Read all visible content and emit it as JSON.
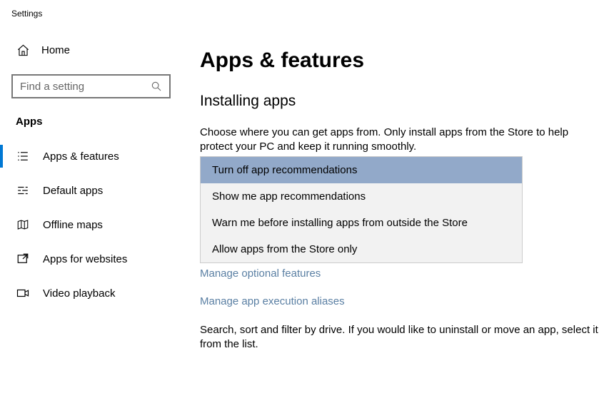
{
  "window_title": "Settings",
  "sidebar": {
    "home_label": "Home",
    "search_placeholder": "Find a setting",
    "section_title": "Apps",
    "items": [
      {
        "label": "Apps & features"
      },
      {
        "label": "Default apps"
      },
      {
        "label": "Offline maps"
      },
      {
        "label": "Apps for websites"
      },
      {
        "label": "Video playback"
      }
    ]
  },
  "main": {
    "title": "Apps & features",
    "subsection": "Installing apps",
    "description": "Choose where you can get apps from. Only install apps from the Store to help protect your PC and keep it running smoothly.",
    "dropdown": {
      "options": [
        "Turn off app recommendations",
        "Show me app recommendations",
        "Warn me before installing apps from outside the Store",
        "Allow apps from the Store only"
      ],
      "selected_index": 0
    },
    "link_optional": "Manage optional features",
    "link_aliases": "Manage app execution aliases",
    "bottom_text": "Search, sort and filter by drive. If you would like to uninstall or move an app, select it from the list."
  }
}
